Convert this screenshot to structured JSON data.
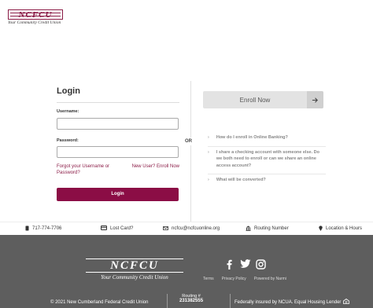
{
  "header": {
    "logo_text": "NCFCU",
    "logo_tagline": "Your Community Credit Union"
  },
  "login": {
    "title": "Login",
    "username_label": "Username:",
    "username_value": "",
    "password_label": "Password:",
    "password_value": "",
    "forgot_link": "Forgot your Username or Password?",
    "new_user_link": "New User? Enroll Now",
    "login_button": "Login"
  },
  "or_label": "OR",
  "enroll": {
    "button_label": "Enroll Now",
    "arrow_icon": "arrow-right-icon"
  },
  "faq": [
    {
      "question": "How do I enroll in Online Banking?"
    },
    {
      "question": "I share a checking account with someone else. Do we both need to enroll or can we share an online access account?"
    },
    {
      "question": "What will be converted?"
    }
  ],
  "infobar": {
    "phone": "717-774-7706",
    "lost_card": "Lost Card?",
    "email": "ncfcu@ncfcuonline.org",
    "routing": "Routing Number",
    "locations": "Location & Hours"
  },
  "footer": {
    "logo_text": "NCFCU",
    "logo_tagline": "Your Community Credit Union",
    "social": [
      "facebook-icon",
      "twitter-icon",
      "instagram-icon"
    ],
    "links": [
      "Terms",
      "Privacy Policy",
      "Powered by Narmi"
    ],
    "copyright": "© 2021 New Cumberland Federal Credit Union",
    "routing_label": "Routing #",
    "routing_number": "231382555",
    "insured": "Federally insured by NCUA. Equal Housing Lender"
  },
  "colors": {
    "brand": "#8b0d45",
    "footer_bg": "#5e5e5e",
    "enroll_bg": "#e3e3e3"
  }
}
